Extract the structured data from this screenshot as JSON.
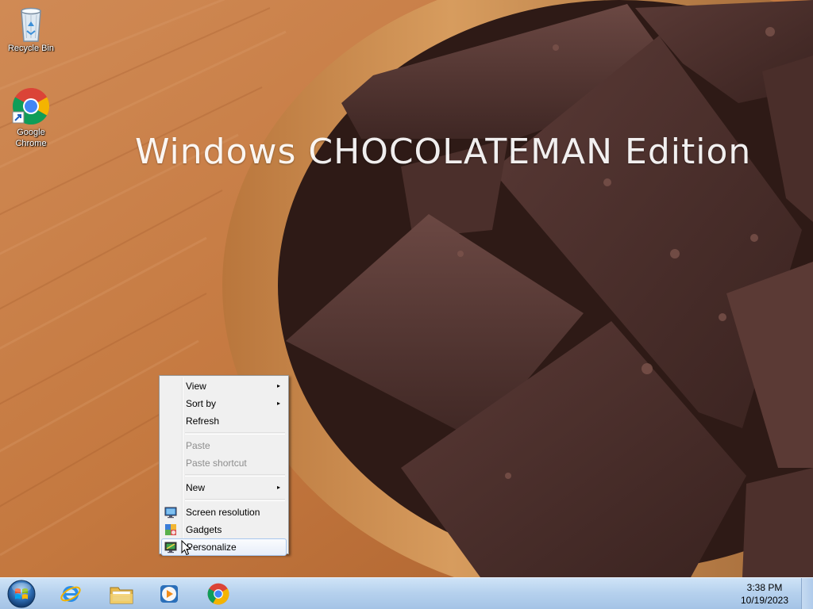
{
  "desktop": {
    "wallpaper_title": "Windows CHOCOLATEMAN Edition",
    "icons": [
      {
        "label": "Recycle Bin",
        "icon": "recycle-bin-icon"
      },
      {
        "label": "Google Chrome",
        "label_line1": "Google",
        "label_line2": "Chrome",
        "icon": "chrome-icon"
      }
    ]
  },
  "context_menu": {
    "items": [
      {
        "label": "View",
        "has_submenu": true,
        "enabled": true
      },
      {
        "label": "Sort by",
        "has_submenu": true,
        "enabled": true
      },
      {
        "label": "Refresh",
        "has_submenu": false,
        "enabled": true
      },
      {
        "label": "Paste",
        "has_submenu": false,
        "enabled": false
      },
      {
        "label": "Paste shortcut",
        "has_submenu": false,
        "enabled": false
      },
      {
        "label": "New",
        "has_submenu": true,
        "enabled": true
      },
      {
        "label": "Screen resolution",
        "icon": "screen-resolution-icon",
        "enabled": true
      },
      {
        "label": "Gadgets",
        "icon": "gadgets-icon",
        "enabled": true
      },
      {
        "label": "Personalize",
        "icon": "personalize-icon",
        "enabled": true,
        "highlighted": true
      }
    ],
    "submenu_arrow": "▸"
  },
  "taskbar": {
    "start_icon": "windows-start-orb-icon",
    "pinned": [
      {
        "name": "Internet Explorer",
        "icon": "internet-explorer-icon"
      },
      {
        "name": "Windows Explorer",
        "icon": "file-explorer-icon"
      },
      {
        "name": "Windows Media Player",
        "icon": "media-player-icon"
      },
      {
        "name": "Google Chrome",
        "icon": "chrome-icon"
      }
    ],
    "clock": {
      "time": "3:38 PM",
      "date": "10/19/2023"
    }
  },
  "colors": {
    "taskbar_top": "#cfe3f7",
    "taskbar_bottom": "#a4c3e6",
    "menu_background": "#f0f0f0",
    "menu_highlight_border": "#a8c7ee",
    "disabled_text": "#8d8d8d"
  }
}
